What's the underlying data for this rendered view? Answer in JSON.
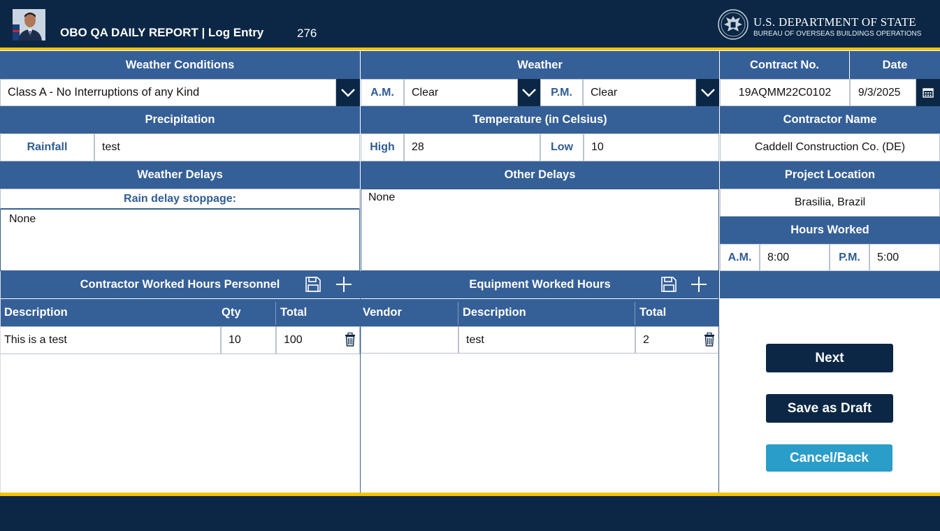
{
  "header": {
    "title": "OBO QA DAILY REPORT | Log Entry",
    "record_id": "276",
    "agency_line1": "U.S. DEPARTMENT OF STATE",
    "agency_line2": "BUREAU OF OVERSEAS BUILDINGS OPERATIONS"
  },
  "weather_conditions": {
    "heading": "Weather Conditions",
    "selected": "Class A - No Interruptions of any Kind"
  },
  "weather": {
    "heading": "Weather",
    "am_label": "A.M.",
    "am_value": "Clear",
    "pm_label": "P.M.",
    "pm_value": "Clear"
  },
  "contract": {
    "heading": "Contract No.",
    "value": "19AQMM22C0102"
  },
  "date": {
    "heading": "Date",
    "value": "9/3/2025"
  },
  "precipitation": {
    "heading": "Precipitation",
    "label": "Rainfall",
    "value": "test"
  },
  "temperature": {
    "heading": "Temperature (in Celsius)",
    "high_label": "High",
    "high_value": "28",
    "low_label": "Low",
    "low_value": "10"
  },
  "contractor": {
    "heading": "Contractor Name",
    "value": "Caddell Construction Co. (DE)"
  },
  "weather_delays": {
    "heading": "Weather Delays",
    "sub_label": "Rain delay stoppage:",
    "value": "None"
  },
  "other_delays": {
    "heading": "Other Delays",
    "value": "None"
  },
  "project_location": {
    "heading": "Project Location",
    "value": "Brasilia, Brazil"
  },
  "hours_worked": {
    "heading": "Hours Worked",
    "am_label": "A.M.",
    "am_value": "8:00",
    "pm_label": "P.M.",
    "pm_value": "5:00"
  },
  "personnel": {
    "heading": "Contractor Worked Hours Personnel",
    "columns": [
      "Description",
      "Qty",
      "Total"
    ],
    "rows": [
      {
        "description": "This is a test",
        "qty": "10",
        "total": "100"
      }
    ]
  },
  "equipment": {
    "heading": "Equipment Worked Hours",
    "columns": [
      "Vendor",
      "Description",
      "Total"
    ],
    "rows": [
      {
        "vendor": "",
        "description": "test",
        "total": "2"
      }
    ]
  },
  "actions": {
    "next": "Next",
    "save_draft": "Save as Draft",
    "cancel": "Cancel/Back"
  },
  "colors": {
    "navy": "#0b2745",
    "band_blue": "#355f97",
    "gold": "#f2c400",
    "cancel_blue": "#2a9dc9",
    "label_blue": "#2e5d92"
  },
  "icons": [
    "user-avatar",
    "chevron-down-icon",
    "calendar-icon",
    "save-icon",
    "plus-icon",
    "trash-icon",
    "state-seal"
  ]
}
